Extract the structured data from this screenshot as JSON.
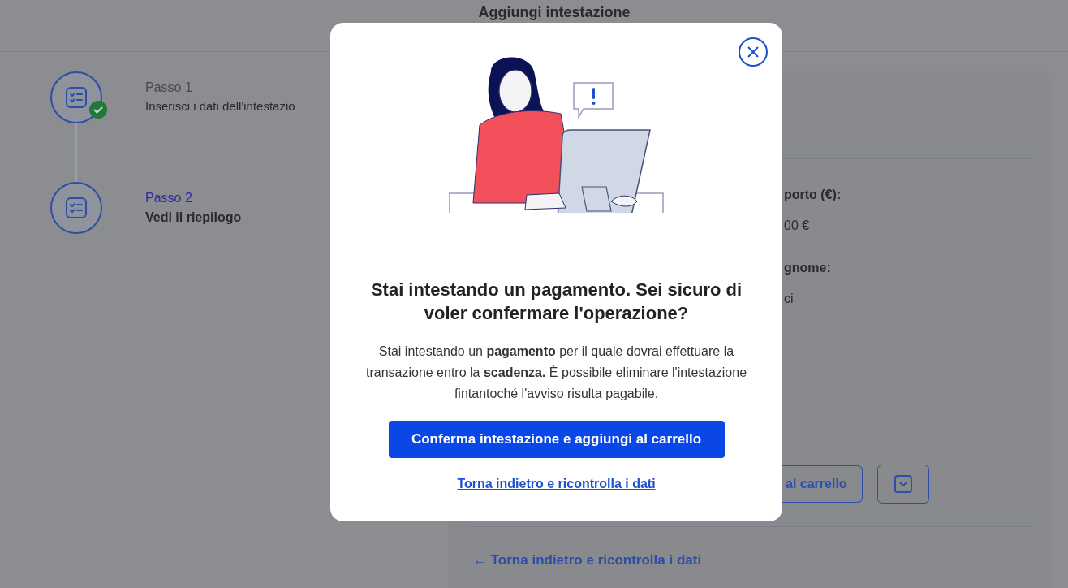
{
  "page": {
    "title": "Aggiungi intestazione"
  },
  "steps": [
    {
      "label": "Passo 1",
      "title": "Inserisci i dati dell'intestazio",
      "completed": true,
      "current": false
    },
    {
      "label": "Passo 2",
      "title": "Vedi il riepilogo",
      "completed": false,
      "current": true
    }
  ],
  "summary": {
    "fields": [
      {
        "label": "porto (€):",
        "value": "00 €"
      },
      {
        "label": "gnome:",
        "value": "ci"
      }
    ],
    "add_button": "al carrello",
    "back_link": "← Torna indietro e ricontrolla i dati"
  },
  "modal": {
    "title": "Stai intestando un pagamento. Sei sicuro di voler confermare l'operazione?",
    "body": "Stai intestando un **pagamento** per il quale dovrai effettuare la transazione entro la **scadenza.** È possibile eliminare l'intestazione fintantoché l'avviso risulta pagabile.",
    "confirm_button": "Conferma intestazione e aggiungi al carrello",
    "back_link": "Torna indietro e ricontrolla i dati"
  }
}
